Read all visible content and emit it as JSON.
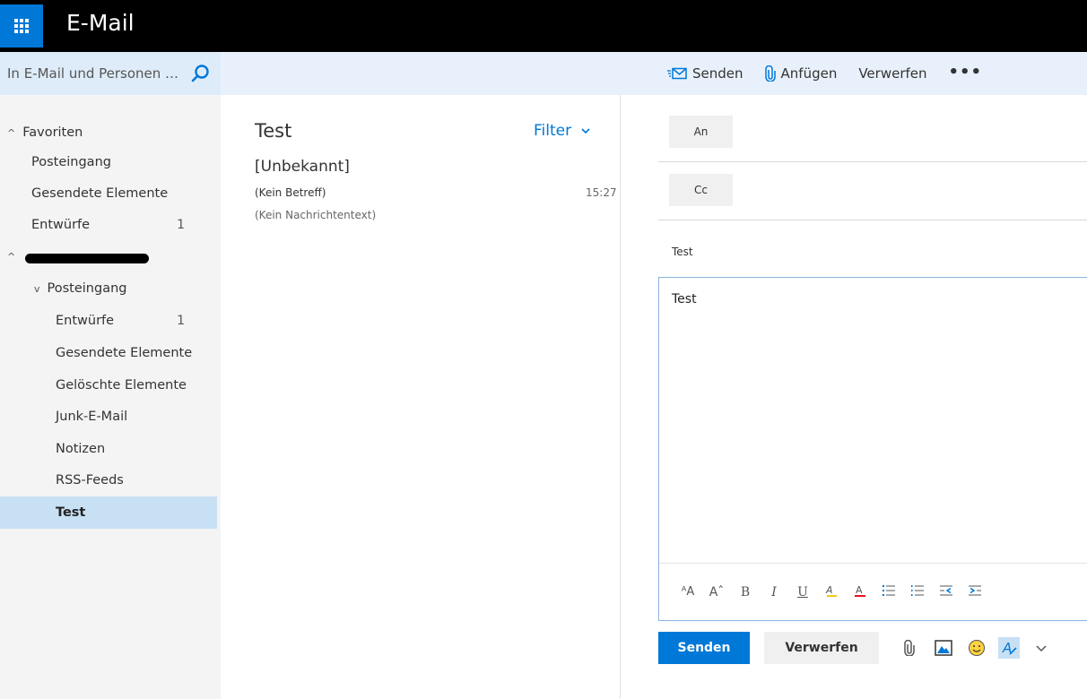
{
  "app": {
    "title": "E-Mail"
  },
  "search": {
    "placeholder": "In E-Mail und Personen suchen"
  },
  "commands": {
    "send": "Senden",
    "attach": "Anfügen",
    "discard": "Verwerfen",
    "more": "•••"
  },
  "folders": {
    "favorites": {
      "label": "Favoriten",
      "items": [
        {
          "label": "Posteingang",
          "count": ""
        },
        {
          "label": "Gesendete Elemente",
          "count": ""
        },
        {
          "label": "Entwürfe",
          "count": "1"
        }
      ]
    },
    "inbox_label": "Posteingang",
    "items": [
      {
        "label": "Entwürfe",
        "count": "1"
      },
      {
        "label": "Gesendete Elemente",
        "count": ""
      },
      {
        "label": "Gelöschte Elemente",
        "count": ""
      },
      {
        "label": "Junk-E-Mail",
        "count": ""
      },
      {
        "label": "Notizen",
        "count": ""
      },
      {
        "label": "RSS-Feeds",
        "count": ""
      }
    ],
    "selected": "Test"
  },
  "list": {
    "title": "Test",
    "filter": "Filter",
    "message": {
      "sender": "[Unbekannt]",
      "subject": "(Kein Betreff)",
      "time": "15:27",
      "preview": "(Kein Nachrichtentext)"
    }
  },
  "compose": {
    "to_label": "An",
    "cc_label": "Cc",
    "subject": "Test",
    "body": "Test",
    "send": "Senden",
    "discard": "Verwerfen"
  },
  "colors": {
    "accent": "#0078d7",
    "selected": "#c7e0f4",
    "topbar": "#000000",
    "band": "#e8f1fb"
  }
}
